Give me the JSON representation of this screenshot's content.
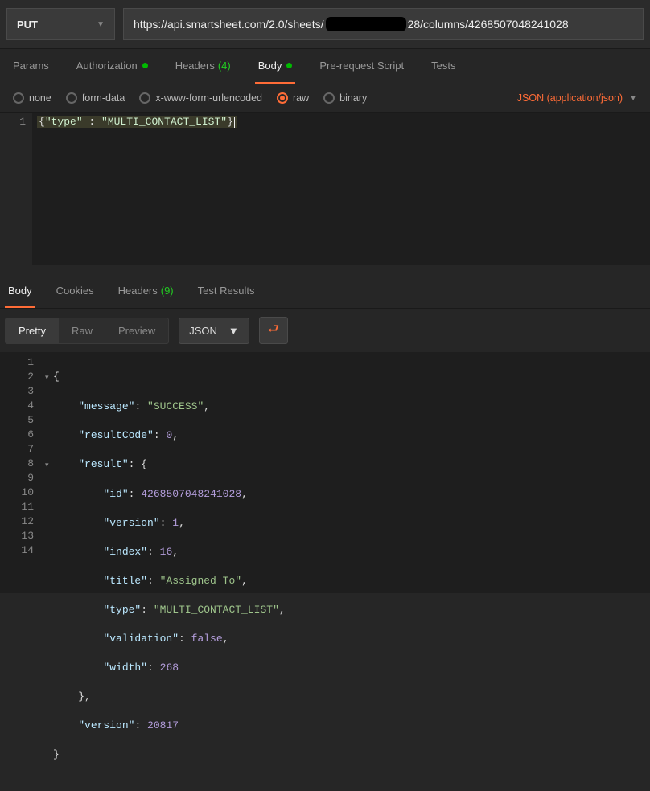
{
  "request": {
    "method": "PUT",
    "url_prefix": "https://api.smartsheet.com/2.0/sheets/",
    "url_suffix": "28/columns/4268507048241028"
  },
  "reqTabs": {
    "params": "Params",
    "authorization": "Authorization",
    "headers": "Headers",
    "headers_count": "(4)",
    "body": "Body",
    "prerequest": "Pre-request Script",
    "tests": "Tests"
  },
  "bodyTypes": {
    "none": "none",
    "formdata": "form-data",
    "urlencoded": "x-www-form-urlencoded",
    "raw": "raw",
    "binary": "binary",
    "content_type": "JSON (application/json)"
  },
  "reqBody": {
    "line_no": "1",
    "open": "{",
    "key": "\"type\"",
    "colon": " : ",
    "value": "\"MULTI_CONTACT_LIST\"",
    "close": "}"
  },
  "respTabs": {
    "body": "Body",
    "cookies": "Cookies",
    "headers": "Headers",
    "headers_count": "(9)",
    "test_results": "Test Results"
  },
  "respView": {
    "pretty": "Pretty",
    "raw": "Raw",
    "preview": "Preview",
    "lang": "JSON"
  },
  "respLines": {
    "1": "1",
    "2": "2",
    "3": "3",
    "4": "4",
    "5": "5",
    "6": "6",
    "7": "7",
    "8": "8",
    "9": "9",
    "10": "10",
    "11": "11",
    "12": "12",
    "13": "13",
    "14": "14"
  },
  "resp": {
    "message_k": "\"message\"",
    "message_v": "\"SUCCESS\"",
    "resultCode_k": "\"resultCode\"",
    "resultCode_v": "0",
    "result_k": "\"result\"",
    "id_k": "\"id\"",
    "id_v": "4268507048241028",
    "version_k": "\"version\"",
    "version_v": "1",
    "index_k": "\"index\"",
    "index_v": "16",
    "title_k": "\"title\"",
    "title_v": "\"Assigned To\"",
    "type_k": "\"type\"",
    "type_v": "\"MULTI_CONTACT_LIST\"",
    "validation_k": "\"validation\"",
    "validation_v": "false",
    "width_k": "\"width\"",
    "width_v": "268",
    "outer_version_k": "\"version\"",
    "outer_version_v": "20817"
  }
}
